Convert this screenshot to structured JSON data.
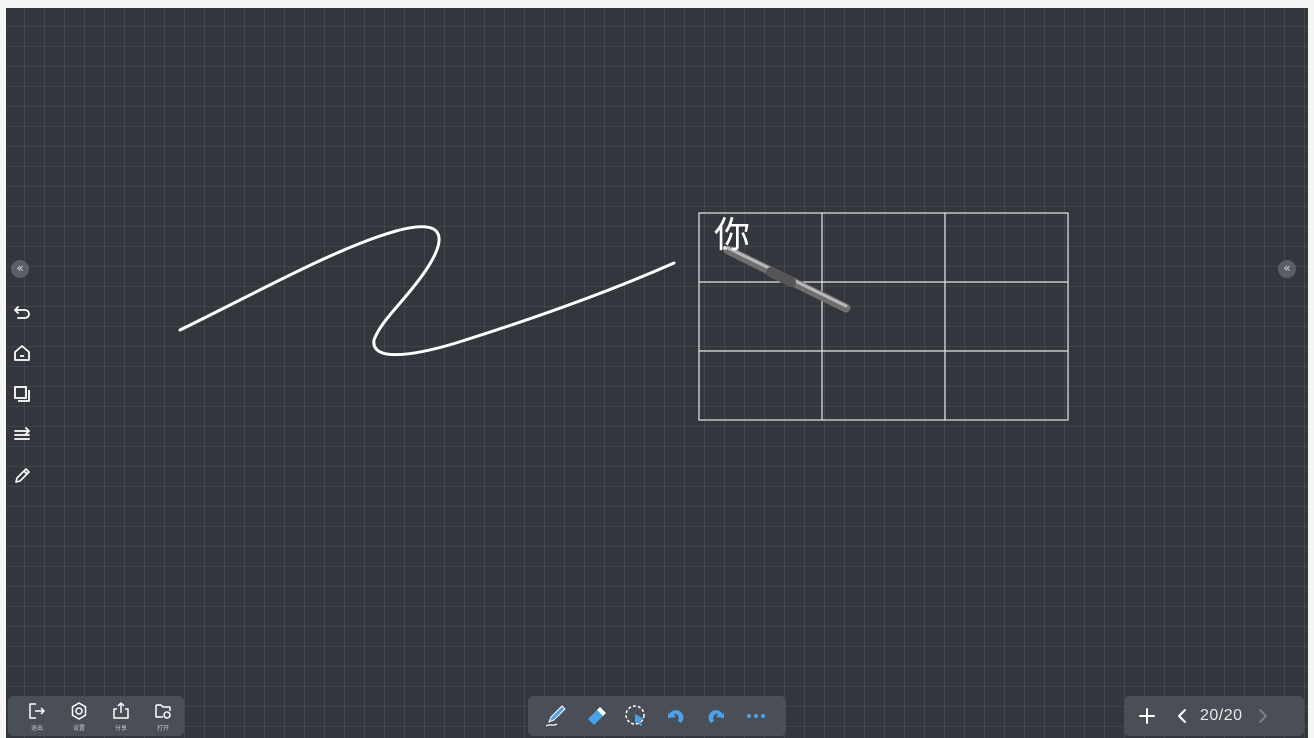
{
  "side": {
    "collapse_left": "«",
    "collapse_right": "«",
    "tools": [
      {
        "icon": "undo-arrow-icon"
      },
      {
        "icon": "home-icon"
      },
      {
        "icon": "layers-icon"
      },
      {
        "icon": "menu-lines-icon"
      },
      {
        "icon": "pencil-icon"
      }
    ]
  },
  "system_bar": {
    "items": [
      {
        "icon": "exit-icon",
        "label": "退出"
      },
      {
        "icon": "settings-icon",
        "label": "设置"
      },
      {
        "icon": "share-icon",
        "label": "分享"
      },
      {
        "icon": "open-folder-icon",
        "label": "打开"
      }
    ]
  },
  "draw_bar": {
    "tools": [
      "pen-icon",
      "eraser-icon",
      "lasso-select-icon",
      "undo-icon",
      "redo-icon",
      "more-icon"
    ]
  },
  "page_bar": {
    "add": "add-page-icon",
    "indicator": "20/20"
  },
  "canvas": {
    "handwritten_char": "你",
    "stroke_color": "#ffffff",
    "accent_color": "#4aa3e8"
  }
}
